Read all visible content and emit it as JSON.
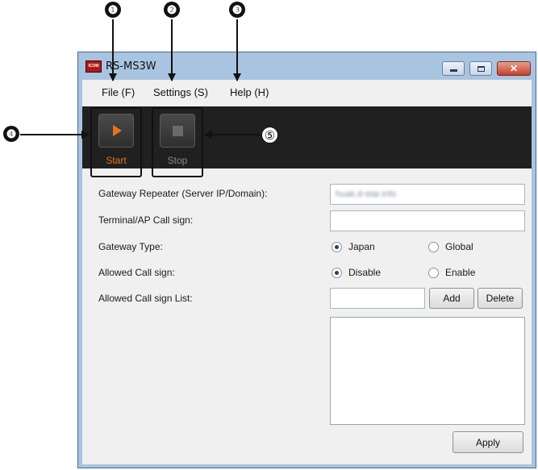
{
  "callouts": [
    "❶",
    "❷",
    "❸",
    "❹",
    "⑤"
  ],
  "window": {
    "title": "RS-MS3W",
    "icon_text": "ICOM"
  },
  "menu": [
    {
      "label": "File (F)"
    },
    {
      "label": "Settings (S)"
    },
    {
      "label": "Help (H)"
    }
  ],
  "toolbar": {
    "start_label": "Start",
    "stop_label": "Stop"
  },
  "form": {
    "gateway_repeater_label": "Gateway Repeater (Server IP/Domain):",
    "gateway_repeater_value": "huak.d-star.info",
    "terminal_callsign_label": "Terminal/AP Call sign:",
    "terminal_callsign_value": "",
    "gateway_type_label": "Gateway Type:",
    "gateway_type_options": [
      "Japan",
      "Global"
    ],
    "gateway_type_selected": "Japan",
    "allowed_callsign_label": "Allowed Call sign:",
    "allowed_callsign_options": [
      "Disable",
      "Enable"
    ],
    "allowed_callsign_selected": "Disable",
    "allowed_list_label": "Allowed Call sign List:",
    "allowed_list_input": "",
    "add_label": "Add",
    "delete_label": "Delete",
    "apply_label": "Apply"
  },
  "colors": {
    "start_accent": "#e8731e",
    "toolbar_bg": "#202020",
    "titlebar_bg": "#a9c4e0",
    "close_button": "#c4402a"
  }
}
